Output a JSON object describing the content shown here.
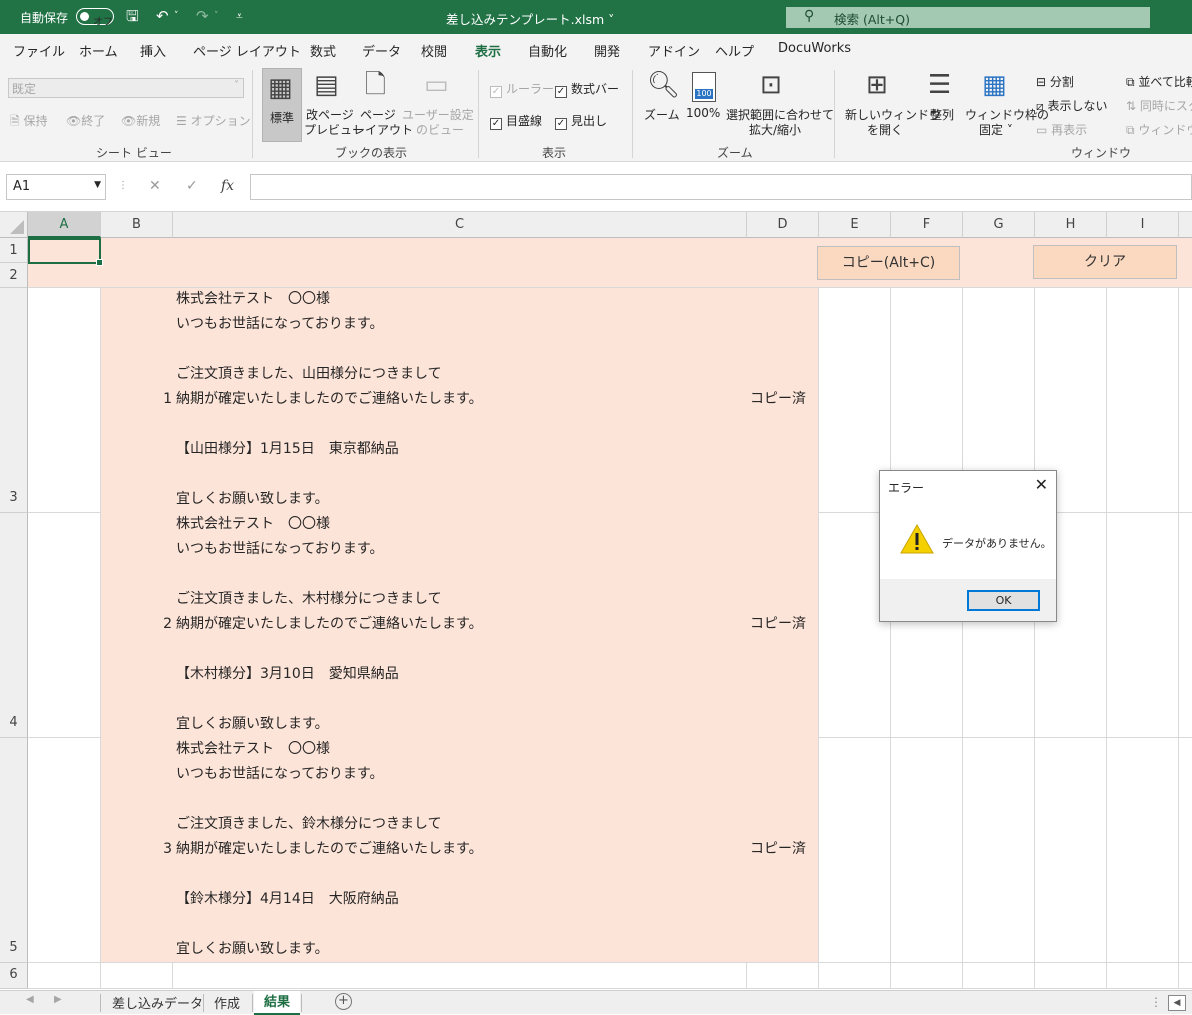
{
  "titlebar": {
    "autosave_label": "自動保存",
    "autosave_state": "オフ",
    "document_title": "差し込みテンプレート.xlsm",
    "search_placeholder": "検索 (Alt+Q)"
  },
  "ribbon_tabs": [
    "ファイル",
    "ホーム",
    "挿入",
    "ページ レイアウト",
    "数式",
    "データ",
    "校閲",
    "表示",
    "自動化",
    "開発",
    "アドイン",
    "ヘルプ",
    "DocuWorks"
  ],
  "active_tab": "表示",
  "ribbon": {
    "sheet_view": {
      "dropdown_value": "既定",
      "keep": "保持",
      "exit": "終了",
      "new": "新規",
      "options": "オプション",
      "group": "シート ビュー"
    },
    "workbook_views": {
      "normal": "標準",
      "page_break_1": "改ページ",
      "page_break_2": "プレビュー",
      "page_layout_1": "ページ",
      "page_layout_2": "レイアウト",
      "custom_1": "ユーザー設定",
      "custom_2": "のビュー",
      "group": "ブックの表示"
    },
    "show": {
      "ruler": "ルーラー",
      "formula_bar": "数式バー",
      "gridlines": "目盛線",
      "headings": "見出し",
      "group": "表示"
    },
    "zoom": {
      "zoom": "ズーム",
      "hundred": "100%",
      "hundred_icon": "100",
      "zoom_sel_1": "選択範囲に合わせて",
      "zoom_sel_2": "拡大/縮小",
      "group": "ズーム"
    },
    "window": {
      "new_window_1": "新しいウィンドウ",
      "new_window_2": "を開く",
      "arrange": "整列",
      "freeze_1": "ウィンドウ枠の",
      "freeze_2": "固定 ˅",
      "split": "分割",
      "hide": "表示しない",
      "unhide": "再表示",
      "side_by_side": "並べて比較",
      "sync_scroll": "同時にスク",
      "reset_pos": "ウィンドウの",
      "group": "ウィンドウ"
    }
  },
  "formula_bar": {
    "name_box": "A1",
    "cancel": "✕",
    "enter": "✓",
    "fx": "fx",
    "content": ""
  },
  "columns": [
    "A",
    "B",
    "C",
    "D",
    "E",
    "F",
    "G",
    "H",
    "I"
  ],
  "rows": [
    "1",
    "2",
    "3",
    "4",
    "5",
    "6"
  ],
  "buttons": {
    "copy": "コピー(Alt+C)",
    "clear": "クリア"
  },
  "records": [
    {
      "num": "1",
      "status": "コピー済",
      "lines": [
        "株式会社テスト　〇〇様",
        "いつもお世話になっております。",
        "",
        "ご注文頂きました、山田様分につきまして",
        "納期が確定いたしましたのでご連絡いたします。",
        "",
        "【山田様分】1月15日　東京都納品",
        "",
        "宜しくお願い致します。"
      ]
    },
    {
      "num": "2",
      "status": "コピー済",
      "lines": [
        "株式会社テスト　〇〇様",
        "いつもお世話になっております。",
        "",
        "ご注文頂きました、木村様分につきまして",
        "納期が確定いたしましたのでご連絡いたします。",
        "",
        "【木村様分】3月10日　愛知県納品",
        "",
        "宜しくお願い致します。"
      ]
    },
    {
      "num": "3",
      "status": "コピー済",
      "lines": [
        "株式会社テスト　〇〇様",
        "いつもお世話になっております。",
        "",
        "ご注文頂きました、鈴木様分につきまして",
        "納期が確定いたしましたのでご連絡いたします。",
        "",
        "【鈴木様分】4月14日　大阪府納品",
        "",
        "宜しくお願い致します。"
      ]
    }
  ],
  "dialog": {
    "title": "エラー",
    "message": "データがありません。",
    "ok": "OK"
  },
  "sheets": [
    "差し込みデータ",
    "作成",
    "結果"
  ],
  "active_sheet": "結果",
  "colors": {
    "excel_green": "#217346",
    "cell_fill": "#fde4d8",
    "button_fill": "#fbd9c1"
  }
}
